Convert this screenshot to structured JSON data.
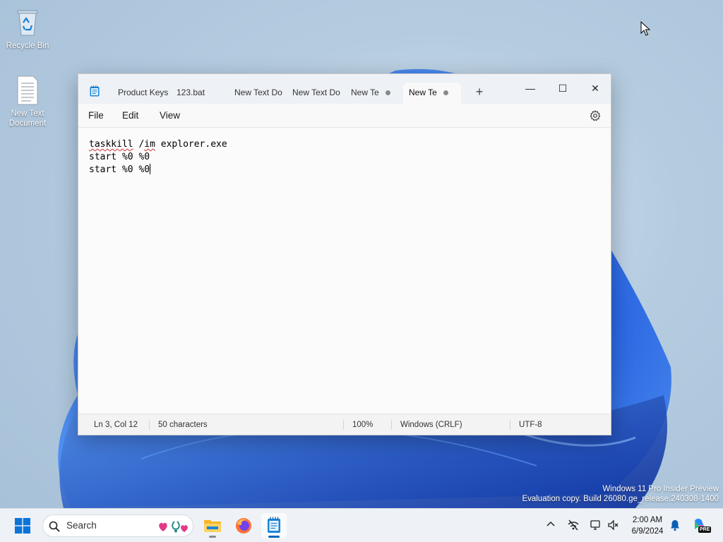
{
  "desktop": {
    "icons": [
      {
        "label": "Recycle Bin"
      },
      {
        "label": "New Text Document"
      }
    ],
    "watermark": {
      "line1": "Windows 11 Pro Insider Preview",
      "line2": "Evaluation copy. Build 26080.ge_release.240308-1400"
    }
  },
  "notepad": {
    "tabs": [
      {
        "label": "Product Keys"
      },
      {
        "label": "123.bat"
      },
      {
        "label": "New Text Do"
      },
      {
        "label": "New Text Do"
      },
      {
        "label": "New Te"
      },
      {
        "label": "New Te"
      }
    ],
    "new_tab_symbol": "+",
    "window_buttons": {
      "minimize": "—",
      "maximize": "☐",
      "close": "✕"
    },
    "menu": {
      "file": "File",
      "edit": "Edit",
      "view": "View"
    },
    "editor": {
      "line1_a": "taskkill",
      "line1_b": " /",
      "line1_c": "im",
      "line1_d": " explorer.exe",
      "line2": "start %0 %0",
      "line3": "start %0 %0"
    },
    "status": {
      "position": "Ln 3, Col 12",
      "characters": "50 characters",
      "zoom": "100%",
      "line_ending": "Windows (CRLF)",
      "encoding": "UTF-8"
    }
  },
  "taskbar": {
    "search_label": "Search",
    "clock": {
      "time": "2:00 AM",
      "date": "6/9/2024"
    },
    "pre_badge": "PRE"
  },
  "colors": {
    "accent": "#0067c0",
    "spellcheck": "#d13438"
  },
  "icons": [
    "recycle-bin-icon",
    "text-file-icon",
    "notepad-icon",
    "settings-gear-icon",
    "windows-start-icon",
    "search-icon",
    "file-explorer-icon",
    "firefox-icon",
    "chevron-up-icon",
    "network-icon",
    "display-icon",
    "volume-icon",
    "notification-bell-icon",
    "copilot-icon"
  ]
}
